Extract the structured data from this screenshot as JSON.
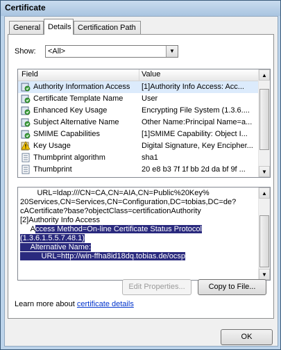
{
  "window": {
    "title": "Certificate"
  },
  "tabs": [
    {
      "label": "General",
      "active": false
    },
    {
      "label": "Details",
      "active": true
    },
    {
      "label": "Certification Path",
      "active": false
    }
  ],
  "show": {
    "label": "Show:",
    "value": "<All>"
  },
  "fields_list": {
    "columns": {
      "field": "Field",
      "value": "Value"
    },
    "rows": [
      {
        "field": "Authority Information Access",
        "value": "[1]Authority Info Access: Acc...",
        "icon": "extension-icon",
        "selected": true
      },
      {
        "field": "Certificate Template Name",
        "value": "User",
        "icon": "extension-icon",
        "selected": false
      },
      {
        "field": "Enhanced Key Usage",
        "value": "Encrypting File System (1.3.6....",
        "icon": "extension-icon",
        "selected": false
      },
      {
        "field": "Subject Alternative Name",
        "value": "Other Name:Principal Name=a...",
        "icon": "extension-icon",
        "selected": false
      },
      {
        "field": "SMIME Capabilities",
        "value": "[1]SMIME Capability: Object I...",
        "icon": "extension-icon",
        "selected": false
      },
      {
        "field": "Key Usage",
        "value": "Digital Signature, Key Encipher...",
        "icon": "critical-extension-icon",
        "selected": false
      },
      {
        "field": "Thumbprint algorithm",
        "value": "sha1",
        "icon": "property-icon",
        "selected": false
      },
      {
        "field": "Thumbprint",
        "value": "20 e8 b3 7f 1f bb 2d da bf 9f ...",
        "icon": "property-icon",
        "selected": false
      }
    ]
  },
  "detail_text": {
    "lines": [
      {
        "pre": "        URL=ldap:///CN=CA,CN=AIA,CN=Public%20Key%",
        "hl": ""
      },
      {
        "pre": "20Services,CN=Services,CN=Configuration,DC=tobias,DC=de?",
        "hl": ""
      },
      {
        "pre": "cACertificate?base?objectClass=certificationAuthority",
        "hl": ""
      },
      {
        "pre": "[2]Authority Info Access",
        "hl": ""
      },
      {
        "pre": "     A",
        "hl": "ccess Method=On-line Certificate Status Protocol"
      },
      {
        "pre": "",
        "hl": "(1.3.6.1.5.5.7.48.1)"
      },
      {
        "pre": "",
        "hl": "     Alternative Name:"
      },
      {
        "pre": "",
        "hl": "          URL=http://win-ffha8id18dq.tobias.de/ocsp"
      }
    ]
  },
  "buttons": {
    "edit_properties": "Edit Properties...",
    "copy_to_file": "Copy to File...",
    "ok": "OK"
  },
  "learn_more": {
    "text": "Learn more about ",
    "link": "certificate details"
  },
  "colors": {
    "selection": "#2a2a7e",
    "row_selected": "#dcebfc",
    "link": "#0033cc"
  }
}
